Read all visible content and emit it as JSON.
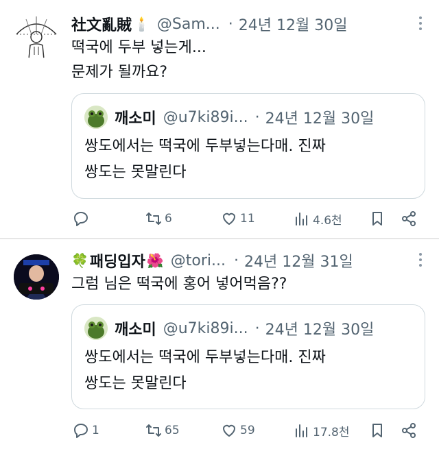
{
  "tweets": [
    {
      "author": {
        "display_name": "社文亂賊",
        "emoji": "🕯️",
        "handle": "@Sam...",
        "avatar": "sketch-portrait-umbrella"
      },
      "dot": "·",
      "date": "24년 12월 30일",
      "text_lines": [
        "떡국에 두부 넣는게...",
        "문제가 될까요?"
      ],
      "quote": {
        "author": {
          "display_name": "깨소미",
          "handle": "@u7ki89i...",
          "avatar": "green-frog-avatar"
        },
        "dot": "·",
        "date": "24년 12월 30일",
        "text_lines": [
          "쌍도에서는 떡국에 두부넣는다매. 진짜",
          "쌍도는 못말린다"
        ]
      },
      "actions": {
        "replies": "",
        "retweets": "6",
        "likes": "11",
        "views": "4.6천"
      }
    },
    {
      "author": {
        "display_name": "패딩입자",
        "emoji_prefix": "🍀",
        "emoji": "🌺",
        "handle": "@tori...",
        "avatar": "bad-girls-portrait"
      },
      "dot": "·",
      "date": "24년 12월 31일",
      "text_lines": [
        "그럼 님은 떡국에 홍어 넣어먹음??"
      ],
      "quote": {
        "author": {
          "display_name": "깨소미",
          "handle": "@u7ki89i...",
          "avatar": "green-frog-avatar"
        },
        "dot": "·",
        "date": "24년 12월 30일",
        "text_lines": [
          "쌍도에서는 떡국에 두부넣는다매. 진짜",
          "쌍도는 못말린다"
        ]
      },
      "actions": {
        "replies": "1",
        "retweets": "65",
        "likes": "59",
        "views": "17.8천"
      }
    }
  ],
  "colors": {
    "text": "#0f1419",
    "secondary": "#536471",
    "border": "#cfd9de"
  }
}
